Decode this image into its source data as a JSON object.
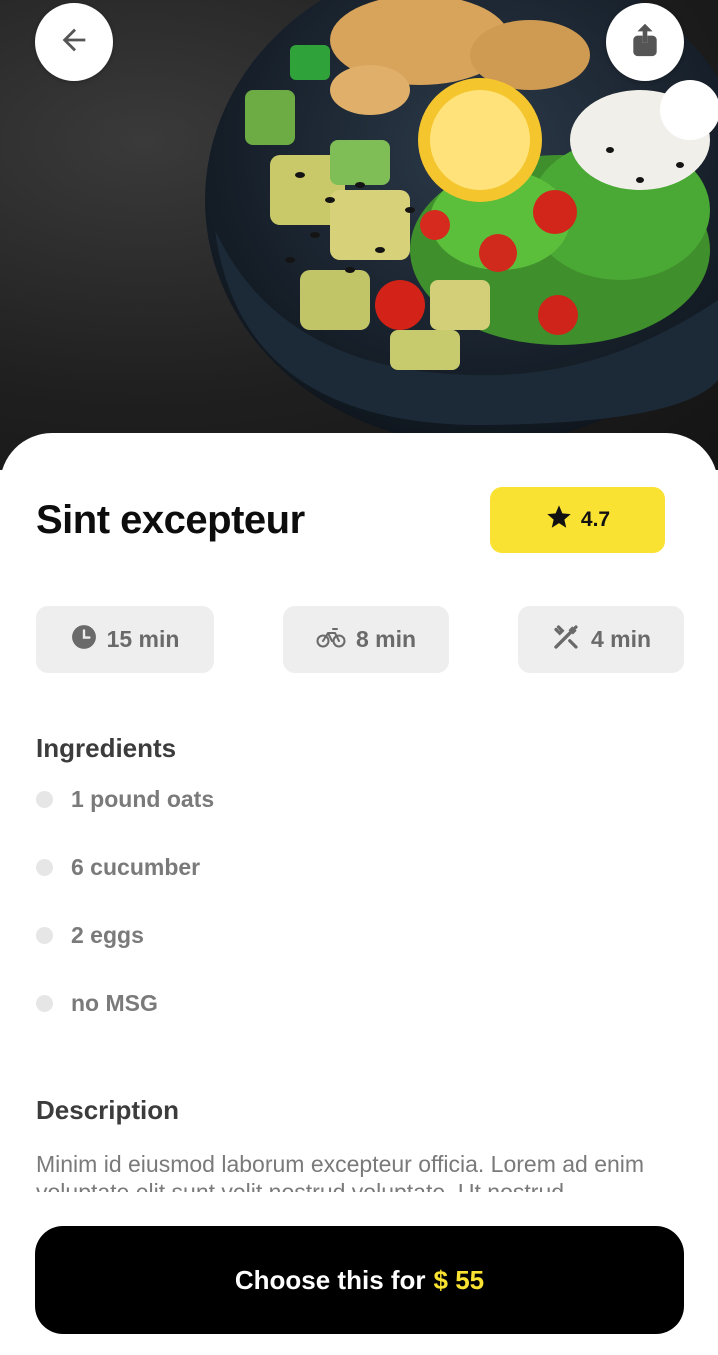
{
  "header": {
    "back_icon": "arrow-left-icon",
    "share_icon": "share-icon"
  },
  "dish": {
    "title": "Sint excepteur",
    "rating": "4.7",
    "rating_icon": "star-icon",
    "accent_color": "#f9e231"
  },
  "stats": [
    {
      "icon": "clock-icon",
      "label": "15 min"
    },
    {
      "icon": "bicycle-icon",
      "label": "8 min"
    },
    {
      "icon": "utensils-icon",
      "label": "4 min"
    }
  ],
  "ingredients": {
    "heading": "Ingredients",
    "items": [
      "1 pound oats",
      "6 cucumber",
      "2 eggs",
      "no MSG"
    ]
  },
  "description": {
    "heading": "Description",
    "text": "Minim id eiusmod laborum excepteur officia. Lorem ad enim voluptate elit sunt velit nostrud voluptate. Ut nostrud"
  },
  "cta": {
    "label": "Choose this for",
    "price": "$ 55"
  }
}
